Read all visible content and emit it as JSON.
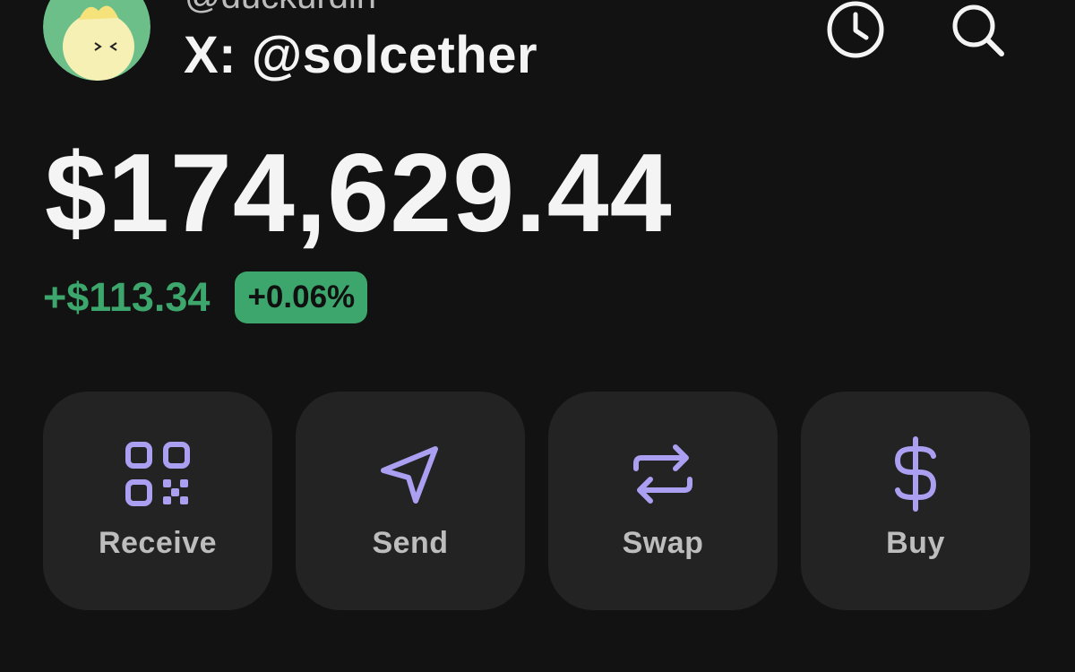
{
  "profile": {
    "top_handle": "@duckurdin",
    "x_handle": "X: @solcether"
  },
  "header_icons": {
    "history": "clock-icon",
    "search": "search-icon"
  },
  "balance": {
    "total": "$174,629.44",
    "change_amount": "+$113.34",
    "change_percent": "+0.06%"
  },
  "actions": [
    {
      "label": "Receive",
      "icon": "qr-code-icon"
    },
    {
      "label": "Send",
      "icon": "send-icon"
    },
    {
      "label": "Swap",
      "icon": "swap-icon"
    },
    {
      "label": "Buy",
      "icon": "dollar-icon"
    }
  ],
  "colors": {
    "background": "#121212",
    "card": "#232323",
    "accent_purple": "#ab9ff2",
    "positive_green": "#3ca66c",
    "text_primary": "#f4f4f4",
    "text_secondary": "#bdbdbd"
  }
}
